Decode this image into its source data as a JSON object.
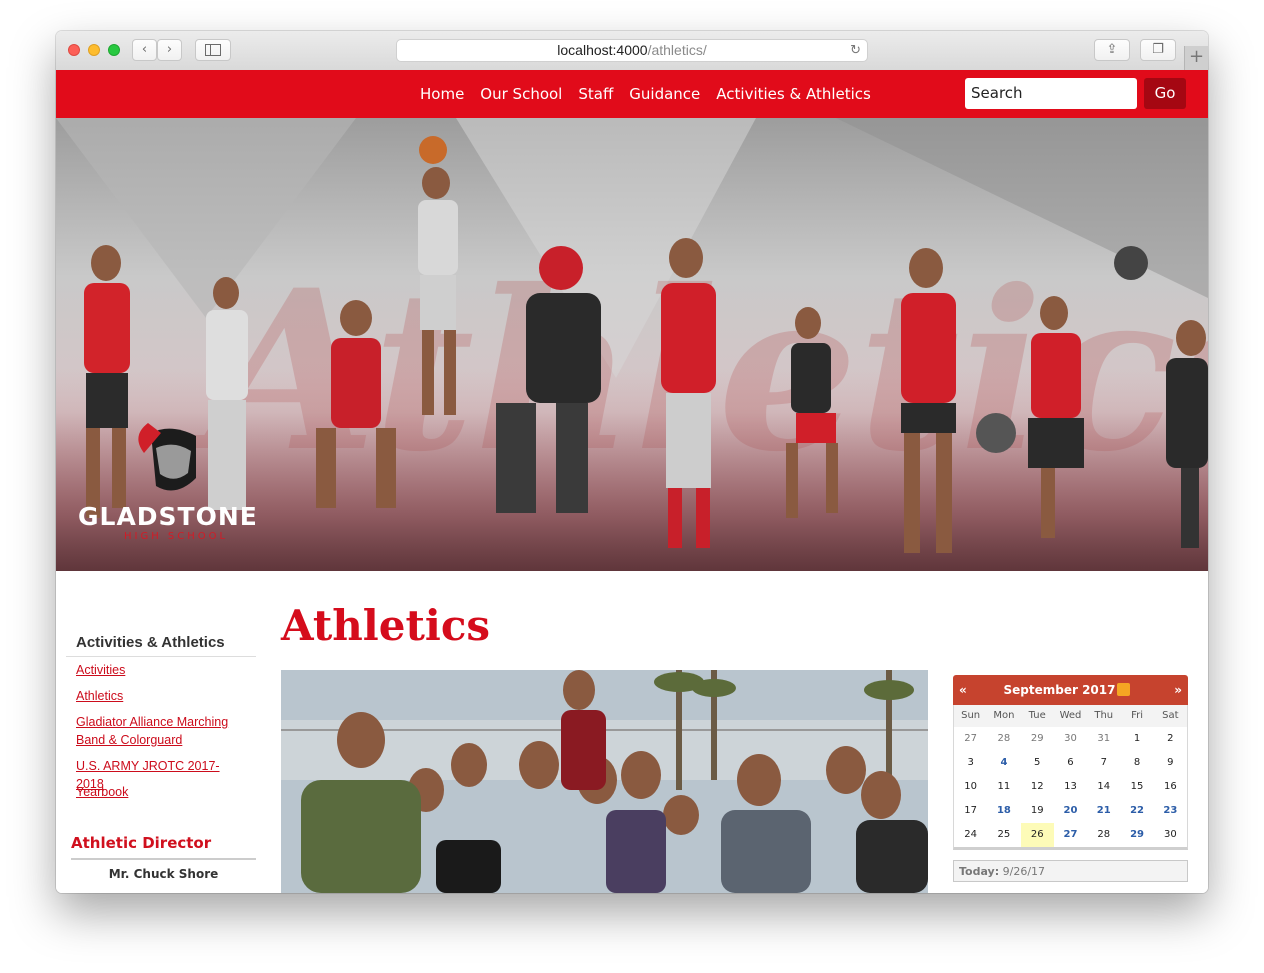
{
  "browser": {
    "url_host": "localhost:4000",
    "url_path": "/athletics/",
    "back_icon": "chevron-left-icon",
    "forward_icon": "chevron-right-icon",
    "sidebar_icon": "sidebar-icon",
    "reload_icon": "reload-icon",
    "share_icon": "share-icon",
    "tabs_icon": "tabs-icon",
    "newtab_icon": "plus-icon"
  },
  "nav": {
    "links": [
      "Home",
      "Our School",
      "Staff",
      "Guidance",
      "Activities & Athletics"
    ],
    "search_placeholder": "Search",
    "go_label": "Go",
    "color": "#e10b1a"
  },
  "hero": {
    "logo_text": "GLADSTONE",
    "logo_sub": "HIGH SCHOOL"
  },
  "sidebar": {
    "title": "Activities & Athletics",
    "links": [
      "Activities",
      "Athletics",
      "Gladiator Alliance Marching Band & Colorguard",
      "U.S. ARMY JROTC 2017-2018",
      "Yearbook"
    ],
    "director_title": "Athletic Director",
    "director_name": "Mr. Chuck Shore"
  },
  "main": {
    "title": "Athletics"
  },
  "calendar": {
    "prev": "«",
    "next": "»",
    "month": "September 2017",
    "rss_icon": "rss-icon",
    "dows": [
      "Sun",
      "Mon",
      "Tue",
      "Wed",
      "Thu",
      "Fri",
      "Sat"
    ],
    "weeks": [
      [
        "27",
        "28",
        "29",
        "30",
        "31",
        "1",
        "2"
      ],
      [
        "3",
        "4",
        "5",
        "6",
        "7",
        "8",
        "9"
      ],
      [
        "10",
        "11",
        "12",
        "13",
        "14",
        "15",
        "16"
      ],
      [
        "17",
        "18",
        "19",
        "20",
        "21",
        "22",
        "23"
      ],
      [
        "24",
        "25",
        "26",
        "27",
        "28",
        "29",
        "30"
      ]
    ],
    "muted_days_week1": [
      "27",
      "28",
      "29",
      "30",
      "31"
    ],
    "event_days": [
      "4",
      "18",
      "20",
      "21",
      "22",
      "23",
      "27",
      "29"
    ],
    "today_day": "26",
    "today_label": "Today:",
    "today_value": "9/26/17",
    "header_color": "#c6432e"
  }
}
